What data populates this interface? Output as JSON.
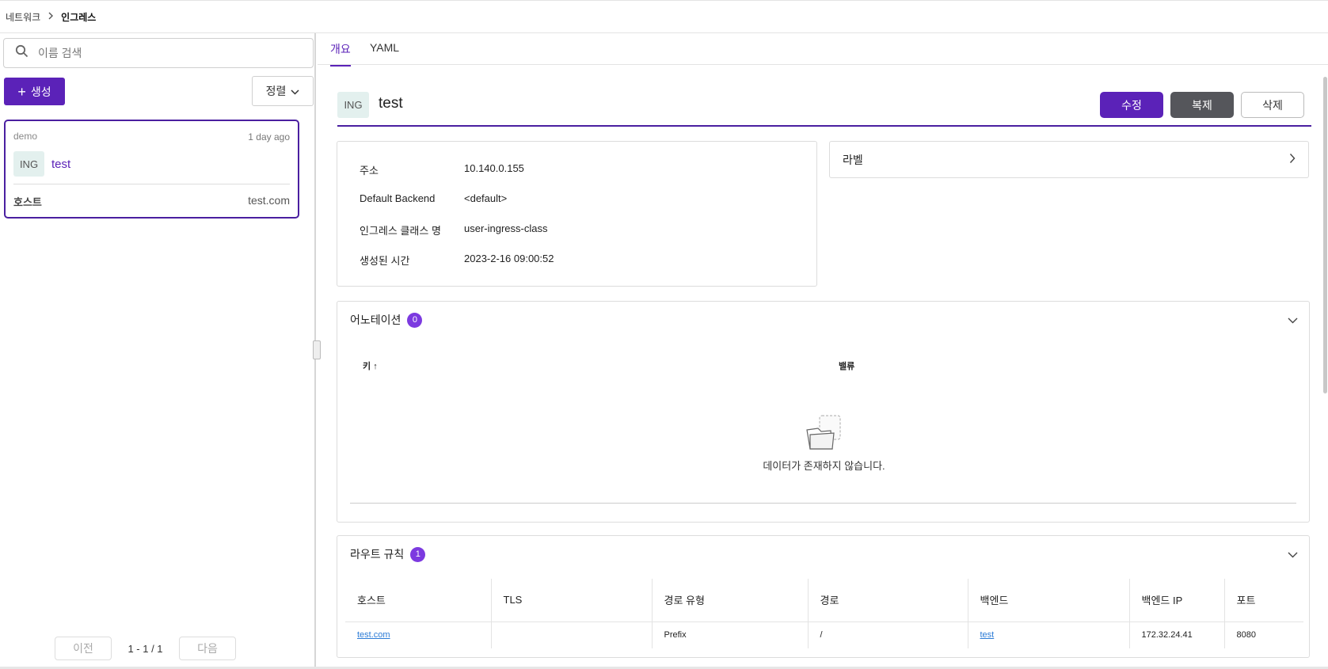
{
  "breadcrumb": {
    "parent": "네트워크",
    "current": "인그레스"
  },
  "left": {
    "search_placeholder": "이름 검색",
    "create_label": "생성",
    "sort_label": "정렬",
    "card": {
      "namespace": "demo",
      "age": "1 day ago",
      "kind_badge": "ING",
      "name": "test",
      "host_label": "호스트",
      "host_value": "test.com"
    },
    "pager": {
      "prev": "이전",
      "info": "1 - 1 / 1",
      "next": "다음"
    }
  },
  "tabs": [
    {
      "label": "개요",
      "active": true
    },
    {
      "label": "YAML",
      "active": false
    }
  ],
  "detail": {
    "kind_badge": "ING",
    "title": "test",
    "edit_label": "수정",
    "copy_label": "복제",
    "delete_label": "삭제",
    "info": [
      {
        "key": "주소",
        "value": "10.140.0.155"
      },
      {
        "key": "Default Backend",
        "value": "<default>"
      },
      {
        "key": "인그레스 클래스 명",
        "value": "user-ingress-class"
      },
      {
        "key": "생성된 시간",
        "value": "2023-2-16 09:00:52"
      }
    ],
    "labels_title": "라벨",
    "annotations": {
      "title": "어노테이션",
      "count": "0",
      "col_key": "키",
      "col_value": "밸류",
      "empty_message": "데이터가 존재하지 않습니다."
    },
    "routes": {
      "title": "라우트 규칙",
      "count": "1",
      "columns": [
        "호스트",
        "TLS",
        "경로 유형",
        "경로",
        "백엔드",
        "백엔드 IP",
        "포트"
      ],
      "rows": [
        {
          "host": "test.com",
          "tls": "",
          "path_type": "Prefix",
          "path": "/",
          "backend": "test",
          "backend_ip": "172.32.24.41",
          "port": "8080"
        }
      ]
    }
  },
  "colors": {
    "accent": "#5b22b8",
    "badge_bg": "#e3f0ee",
    "count_badge": "#7c3ae0",
    "link": "#2b7bd6"
  }
}
